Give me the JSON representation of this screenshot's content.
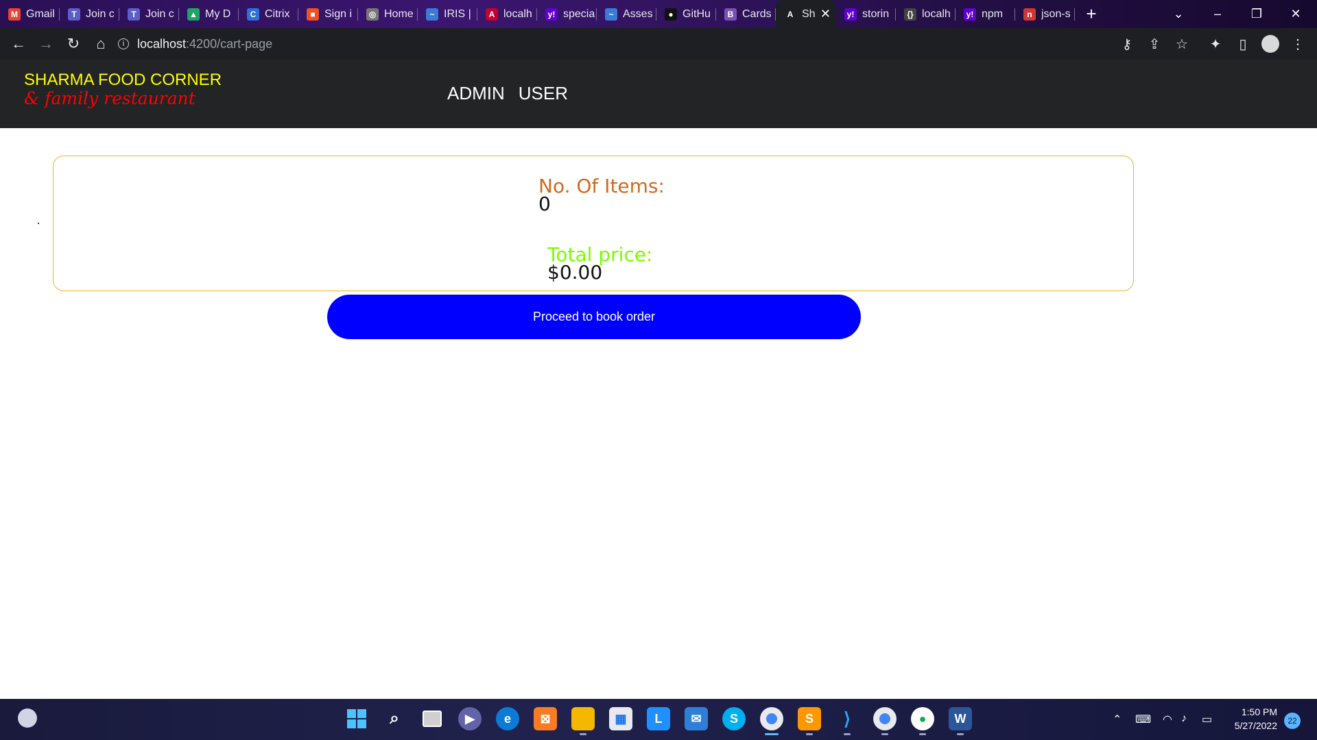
{
  "browser": {
    "tabs": [
      {
        "title": "Gmail",
        "icon": "gmail-icon",
        "color": "#ea4335",
        "glyph": "M"
      },
      {
        "title": "Join c",
        "icon": "teams-icon",
        "color": "#5b5fc7",
        "glyph": "T"
      },
      {
        "title": "Join c",
        "icon": "teams-icon",
        "color": "#5b5fc7",
        "glyph": "T"
      },
      {
        "title": "My D",
        "icon": "drive-icon",
        "color": "#1fa463",
        "glyph": "▲"
      },
      {
        "title": "Citrix",
        "icon": "citrix-icon",
        "color": "#2f6fd6",
        "glyph": "C"
      },
      {
        "title": "Sign i",
        "icon": "microsoft-icon",
        "color": "#f25022",
        "glyph": "■"
      },
      {
        "title": "Home",
        "icon": "globe-icon",
        "color": "#777777",
        "glyph": "◎"
      },
      {
        "title": "IRIS |",
        "icon": "iris-icon",
        "color": "#3a7bd5",
        "glyph": "~"
      },
      {
        "title": "localh",
        "icon": "angular-icon",
        "color": "#c3002f",
        "glyph": "A"
      },
      {
        "title": "specia",
        "icon": "yahoo-icon",
        "color": "#6001d2",
        "glyph": "y!"
      },
      {
        "title": "Asses",
        "icon": "iris-icon",
        "color": "#3a7bd5",
        "glyph": "~"
      },
      {
        "title": "GitHu",
        "icon": "github-icon",
        "color": "#111111",
        "glyph": "●"
      },
      {
        "title": "Cards",
        "icon": "bootstrap-icon",
        "color": "#7952b3",
        "glyph": "B"
      },
      {
        "title": "Sh",
        "icon": "angular-icon",
        "color": "#1e1f22",
        "glyph": "A",
        "active": true
      },
      {
        "title": "storin",
        "icon": "yahoo-icon",
        "color": "#6001d2",
        "glyph": "y!"
      },
      {
        "title": "localh",
        "icon": "json-server-icon",
        "color": "#444444",
        "glyph": "{}"
      },
      {
        "title": "npm",
        "icon": "yahoo-icon",
        "color": "#6001d2",
        "glyph": "y!"
      },
      {
        "title": "json-s",
        "icon": "npm-icon",
        "color": "#cb3837",
        "glyph": "n"
      }
    ],
    "url_host": "localhost",
    "url_path": ":4200/cart-page"
  },
  "site": {
    "brand_name": "SHARMA FOOD CORNER",
    "brand_tagline": "& family restaurant",
    "nav": [
      "ADMIN",
      "USER"
    ]
  },
  "cart": {
    "items_label": "No. Of Items:",
    "items_value": "0",
    "total_label": "Total price:",
    "total_value": "$0.00",
    "book_button": "Proceed to book order"
  },
  "colors": {
    "brand_name": "#ffff00",
    "brand_tagline": "#ff0000",
    "items_label": "#d2691e",
    "total_label": "#7cfc00",
    "box_border": "#f2b227",
    "book_button_bg": "#0000ff",
    "header_bg": "#222426"
  },
  "taskbar": {
    "time": "1:50 PM",
    "date": "5/27/2022",
    "notifications": "22"
  }
}
